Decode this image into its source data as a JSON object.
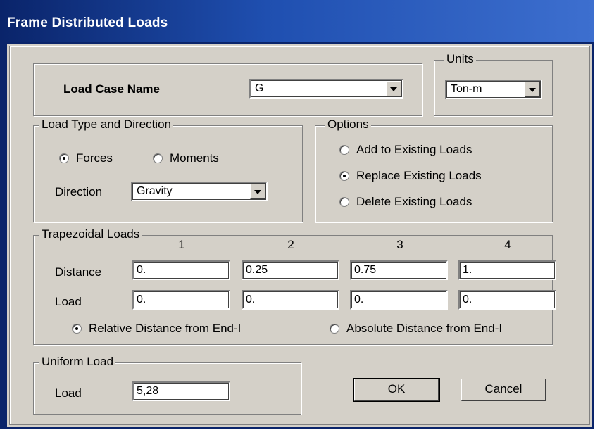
{
  "window": {
    "title": "Frame Distributed Loads"
  },
  "load_case": {
    "label": "Load Case Name",
    "value": "G"
  },
  "units": {
    "legend": "Units",
    "value": "Ton-m"
  },
  "load_type": {
    "legend": "Load Type and Direction",
    "forces_label": "Forces",
    "moments_label": "Moments",
    "selected": "Forces",
    "direction_label": "Direction",
    "direction_value": "Gravity"
  },
  "options": {
    "legend": "Options",
    "add_label": "Add to Existing Loads",
    "replace_label": "Replace Existing Loads",
    "delete_label": "Delete Existing Loads",
    "selected": "Replace Existing Loads"
  },
  "trapezoidal": {
    "legend": "Trapezoidal Loads",
    "columns": [
      "1",
      "2",
      "3",
      "4"
    ],
    "distance_label": "Distance",
    "load_label": "Load",
    "distances": [
      "0.",
      "0.25",
      "0.75",
      "1."
    ],
    "loads": [
      "0.",
      "0.",
      "0.",
      "0."
    ],
    "relative_label": "Relative Distance from End-I",
    "absolute_label": "Absolute Distance from End-I",
    "selected": "Relative Distance from End-I"
  },
  "uniform": {
    "legend": "Uniform Load",
    "load_label": "Load",
    "value": "5,28"
  },
  "buttons": {
    "ok": "OK",
    "cancel": "Cancel"
  }
}
